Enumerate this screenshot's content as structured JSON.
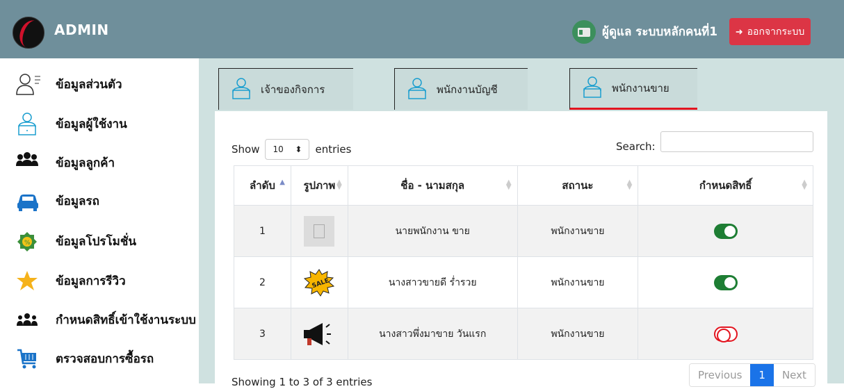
{
  "header": {
    "brand": "ADMIN",
    "user_label": "ผู้ดูแล ระบบหลักคนที่1",
    "logout_label": "ออกจากระบบ"
  },
  "sidebar": {
    "items": [
      {
        "label": "ข้อมูลส่วนตัว",
        "icon": "profile-icon"
      },
      {
        "label": "ข้อมูลผู้ใช้งาน",
        "icon": "user-laptop-icon"
      },
      {
        "label": "ข้อมูลลูกค้า",
        "icon": "customers-icon"
      },
      {
        "label": "ข้อมูลรถ",
        "icon": "car-icon"
      },
      {
        "label": "ข้อมูลโปรโมชั่น",
        "icon": "promotion-icon"
      },
      {
        "label": "ข้อมูลการรีวิว",
        "icon": "star-icon"
      },
      {
        "label": "กำหนดสิทธิ์เข้าใช้งานระบบ",
        "icon": "permission-icon"
      },
      {
        "label": "ตรวจสอบการซื้อรถ",
        "icon": "cart-icon"
      }
    ]
  },
  "tabs": [
    {
      "label": "เจ้าของกิจการ"
    },
    {
      "label": "พนักงานบัญชี"
    },
    {
      "label": "พนักงานขาย"
    }
  ],
  "table_controls": {
    "show_label": "Show",
    "entries_value": "10",
    "entries_label": "entries",
    "search_label": "Search:"
  },
  "table": {
    "headers": [
      "ลำดับ",
      "รูปภาพ",
      "ชื่อ - นามสกุล",
      "สถานะ",
      "กำหนดสิทธิ์"
    ],
    "rows": [
      {
        "no": "1",
        "image": "placeholder-image",
        "name": "นายพนักงาน ขาย",
        "status": "พนักงานขาย",
        "permission": true
      },
      {
        "no": "2",
        "image": "sale-badge",
        "name": "นางสาวขายดี ร่ำรวย",
        "status": "พนักงานขาย",
        "permission": true
      },
      {
        "no": "3",
        "image": "megaphone",
        "name": "นางสาวพึ่งมาขาย วันแรก",
        "status": "พนักงานขาย",
        "permission": false
      }
    ]
  },
  "footer": {
    "info": "Showing 1 to 3 of 3 entries",
    "prev": "Previous",
    "page": "1",
    "next": "Next"
  },
  "colors": {
    "topbar": "#6f8f9b",
    "content_bg": "#cfe1e0",
    "logout": "#dc3545",
    "toggle_on": "#1e7e34",
    "toggle_off": "#e3141f",
    "active_page": "#1a73e8"
  }
}
